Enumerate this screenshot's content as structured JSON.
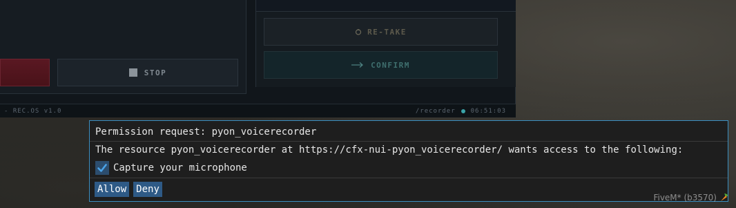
{
  "recorder": {
    "stop_label": "STOP",
    "retake_label": "RE-TAKE",
    "confirm_label": "CONFIRM",
    "status_left": "- REC.OS v1.0",
    "status_route": "/recorder",
    "status_time": "06:51:03"
  },
  "permission_dialog": {
    "title": "Permission request: pyon_voicerecorder",
    "description": "The resource pyon_voicerecorder at https://cfx-nui-pyon_voicerecorder/ wants access to the following:",
    "permissions": [
      {
        "label": "Capture your microphone",
        "checked": true
      }
    ],
    "allow_label": "Allow",
    "deny_label": "Deny"
  },
  "watermark": {
    "text": "FiveM* (b3570)",
    "icon": "carrot-icon"
  },
  "colors": {
    "dialog_border": "#3b8fc1",
    "button_bg": "#2e5a86",
    "status_dot": "#3aa3a8",
    "record_button": "#5a1822"
  }
}
